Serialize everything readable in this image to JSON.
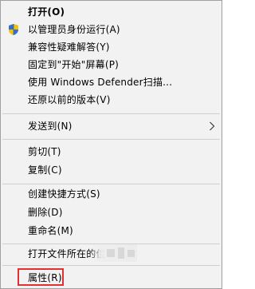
{
  "context_menu": {
    "items": [
      {
        "label": "打开(O)"
      },
      {
        "label": "以管理员身份运行(A)",
        "icon": "uac-shield-icon"
      },
      {
        "label": "兼容性疑难解答(Y)"
      },
      {
        "label": "固定到\"开始\"屏幕(P)"
      },
      {
        "label": "使用 Windows Defender扫描..."
      },
      {
        "label": "还原以前的版本(V)"
      },
      {
        "label": "发送到(N)",
        "icon": "chevron-right-icon"
      },
      {
        "label": "剪切(T)"
      },
      {
        "label": "复制(C)"
      },
      {
        "label": "创建快捷方式(S)"
      },
      {
        "label": "删除(D)"
      },
      {
        "label": "重命名(M)"
      },
      {
        "label": "打开文件所在的位"
      },
      {
        "label": "属性(R)"
      }
    ]
  },
  "colors": {
    "menu_background": "#f2f2f2",
    "menu_border": "#a0a0a0",
    "separator": "#cfcfcf",
    "highlight_box": "#e03030"
  }
}
